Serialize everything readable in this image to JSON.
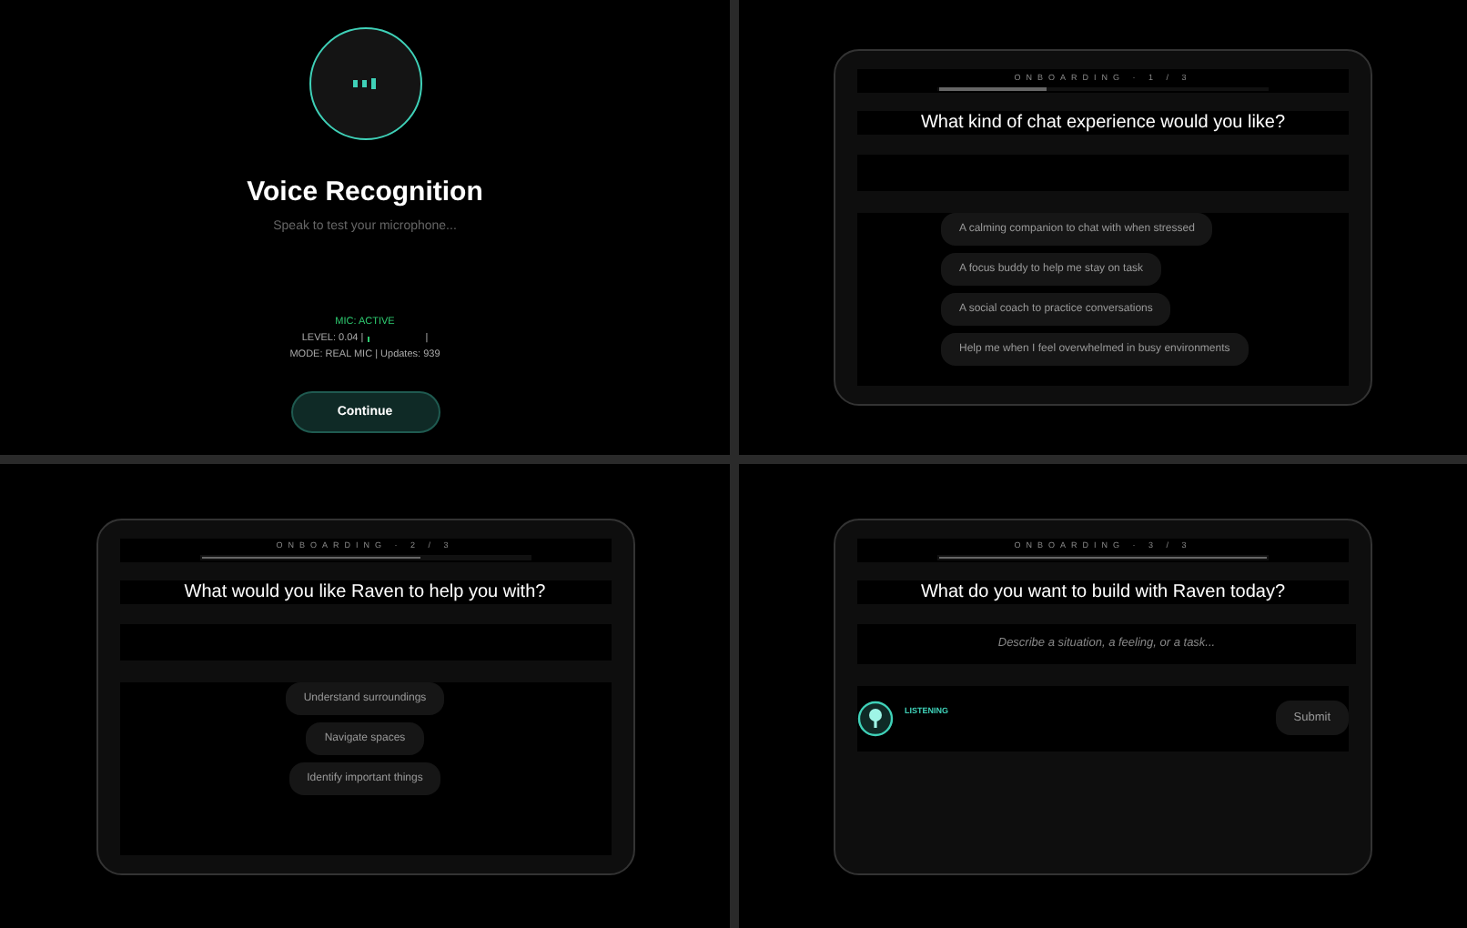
{
  "voice": {
    "title": "Voice Recognition",
    "subtitle": "Speak to test your microphone...",
    "mic_status": "MIC: ACTIVE",
    "level_label": "LEVEL: 0.04 |",
    "level": 0.04,
    "level_end": "|",
    "mode": "MODE: REAL MIC | Updates: 939",
    "button": "Continue"
  },
  "steps": [
    {
      "kind": "options",
      "step": "ONBOARDING · 1 / 3",
      "level": 0.33,
      "question": "What kind of chat experience would you like?",
      "options": [
        "A calming companion to chat with when stressed",
        "A focus buddy to help me stay on task",
        "A social coach to practice conversations",
        "Help me when I feel overwhelmed in busy environments"
      ]
    },
    {
      "kind": "options",
      "step": "ONBOARDING · 2 / 3",
      "level": 0.67,
      "question": "What would you like Raven to help you with?",
      "options": [
        "Understand surroundings",
        "Navigate spaces",
        "Identify important things"
      ]
    },
    {
      "kind": "input",
      "step": "ONBOARDING · 3 / 3",
      "level": 1,
      "question": "What do you want to build with Raven today?",
      "placeholder": "Describe a situation, a feeling, or a task...",
      "listening": "LISTENING",
      "button": "Submit"
    }
  ]
}
